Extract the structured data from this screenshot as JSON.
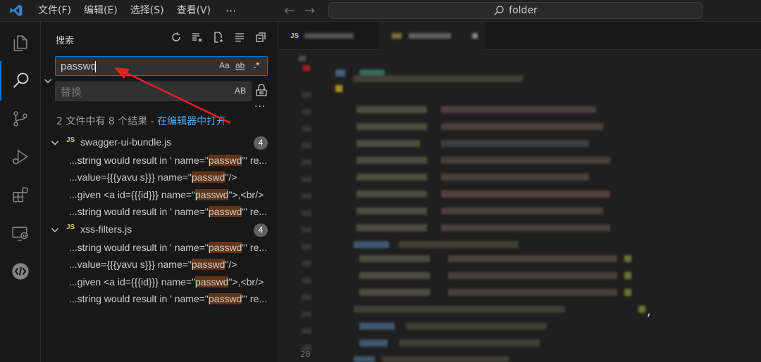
{
  "titlebar": {
    "menus": [
      "文件(F)",
      "编辑(E)",
      "选择(S)",
      "查看(V)"
    ],
    "more": "···",
    "command_center_text": "folder"
  },
  "activitybar": {
    "icons": [
      "explorer-icon",
      "search-icon",
      "source-control-icon",
      "run-debug-icon",
      "extensions-icon",
      "remote-explorer-icon",
      "api-icon"
    ]
  },
  "sidebar": {
    "title": "搜索",
    "search": {
      "value": "passwd",
      "options": [
        "Aa",
        "ab",
        ".*"
      ]
    },
    "replace": {
      "placeholder": "替换",
      "option": "AB"
    },
    "more": "···",
    "summary": "2 文件中有 8 个结果 - ",
    "open_in_editor": "在编辑器中打开",
    "files": [
      {
        "icon": "JS",
        "name": "swagger-ui-bundle.js",
        "count": "4",
        "matches": [
          {
            "pre": "...string would result in ' name=\"",
            "hit": "passwd",
            "post": "\"' re..."
          },
          {
            "pre": "...value={{{yavu s}}} name=\"",
            "hit": "passwd",
            "post": "\"/>"
          },
          {
            "pre": "...given <a id={{{id}}} name=\"",
            "hit": "passwd",
            "post": "\">,<br/>"
          },
          {
            "pre": "...string would result in ' name=\"",
            "hit": "passwd",
            "post": "\"' re..."
          }
        ]
      },
      {
        "icon": "JS",
        "name": "xss-filters.js",
        "count": "4",
        "matches": [
          {
            "pre": "...string would result in ' name=\"",
            "hit": "passwd",
            "post": "\"' re..."
          },
          {
            "pre": "...value={{{yavu s}}} name=\"",
            "hit": "passwd",
            "post": "\"/>"
          },
          {
            "pre": "...given <a id={{{id}}} name=\"",
            "hit": "passwd",
            "post": "\">,<br/>"
          },
          {
            "pre": "...string would result in ' name=\"",
            "hit": "passwd",
            "post": "\"' re..."
          }
        ]
      }
    ]
  },
  "editor": {
    "tab_icon": "JS",
    "line_number_visible": "20",
    "trailing_char": ","
  },
  "colors": {
    "accent": "#0078d4",
    "match_highlight": "#623315",
    "link": "#4daafc",
    "annotation": "#e8211d"
  }
}
